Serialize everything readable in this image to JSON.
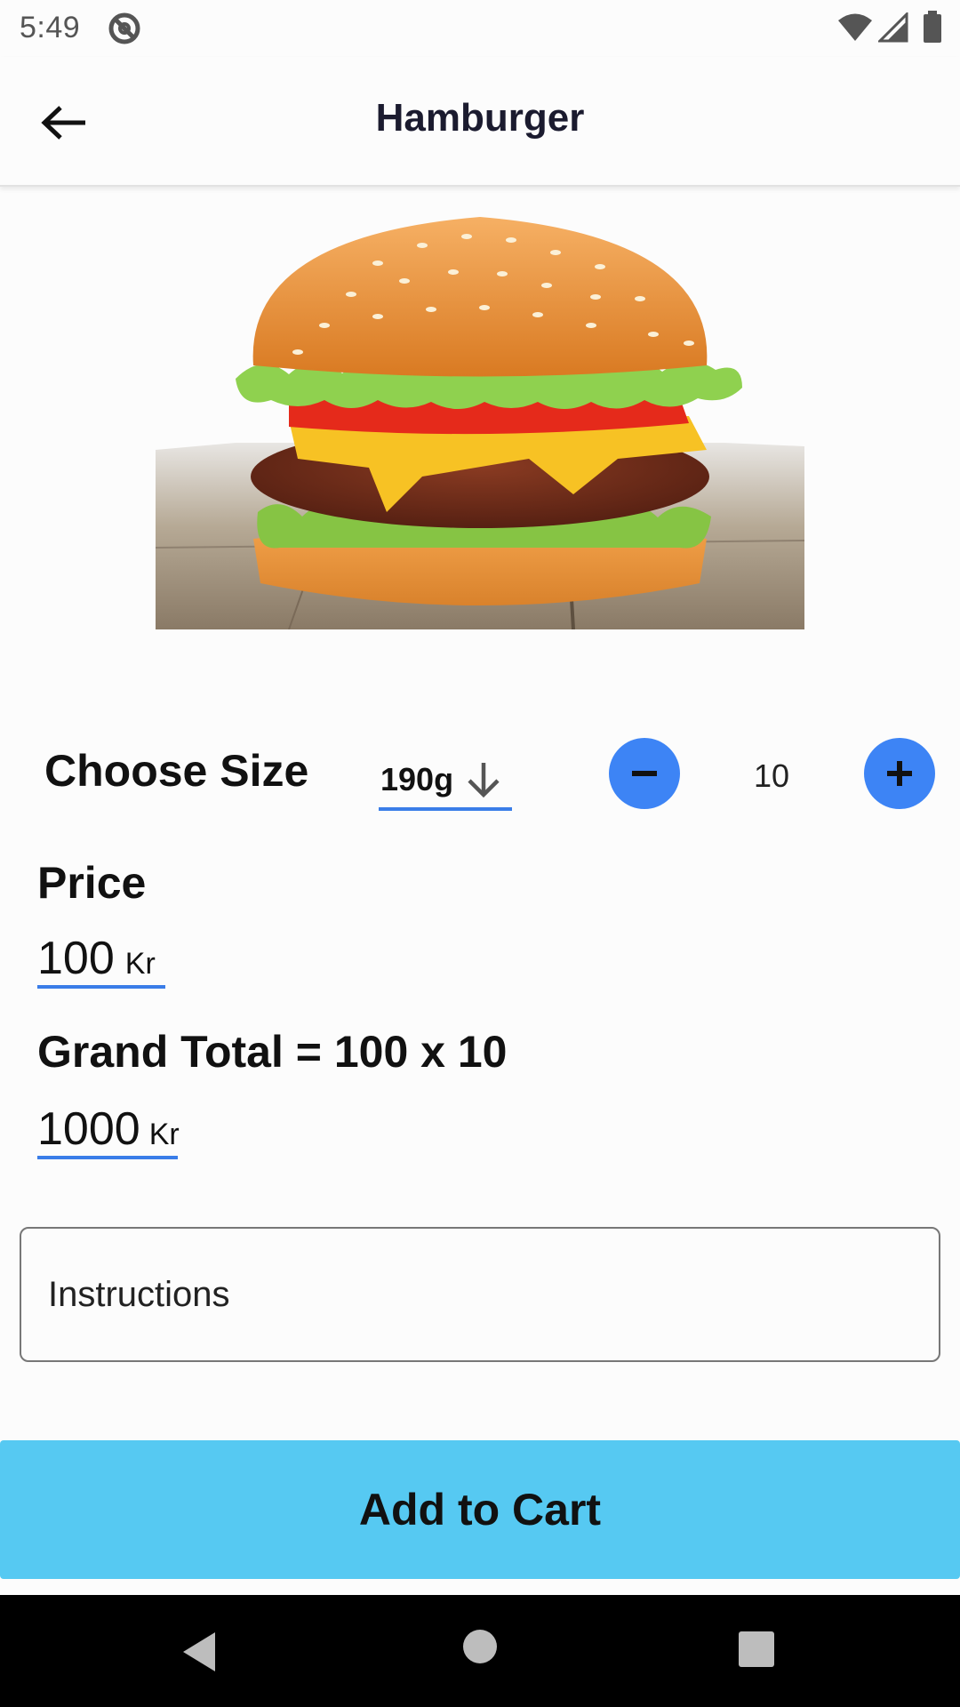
{
  "status_bar": {
    "time": "5:49",
    "icons": [
      "do-not-disturb-icon",
      "wifi-icon",
      "signal-icon",
      "battery-icon"
    ]
  },
  "app_bar": {
    "title": "Hamburger",
    "back_icon": "arrow-left-icon"
  },
  "product": {
    "image": "hamburger-photo"
  },
  "size": {
    "label": "Choose Size",
    "selected": "190g",
    "dropdown_icon": "arrow-down-icon"
  },
  "quantity": {
    "value": "10",
    "minus_icon": "minus-icon",
    "plus_icon": "plus-icon"
  },
  "price": {
    "label": "Price",
    "value": "100",
    "unit": "Kr"
  },
  "grand_total": {
    "label": "Grand Total = 100 x 10",
    "value": "1000",
    "unit": "Kr"
  },
  "instructions": {
    "placeholder": "Instructions",
    "value": ""
  },
  "actions": {
    "add_to_cart_label": "Add to Cart"
  },
  "nav_bar": {
    "icons": [
      "nav-back-icon",
      "nav-home-icon",
      "nav-recents-icon"
    ]
  },
  "colors": {
    "accent_blue": "#3d84f5",
    "underline_blue": "#3a7de8",
    "cart_button": "#56c9f2",
    "nav_bar": "#000000",
    "background": "#fcfcfc"
  }
}
